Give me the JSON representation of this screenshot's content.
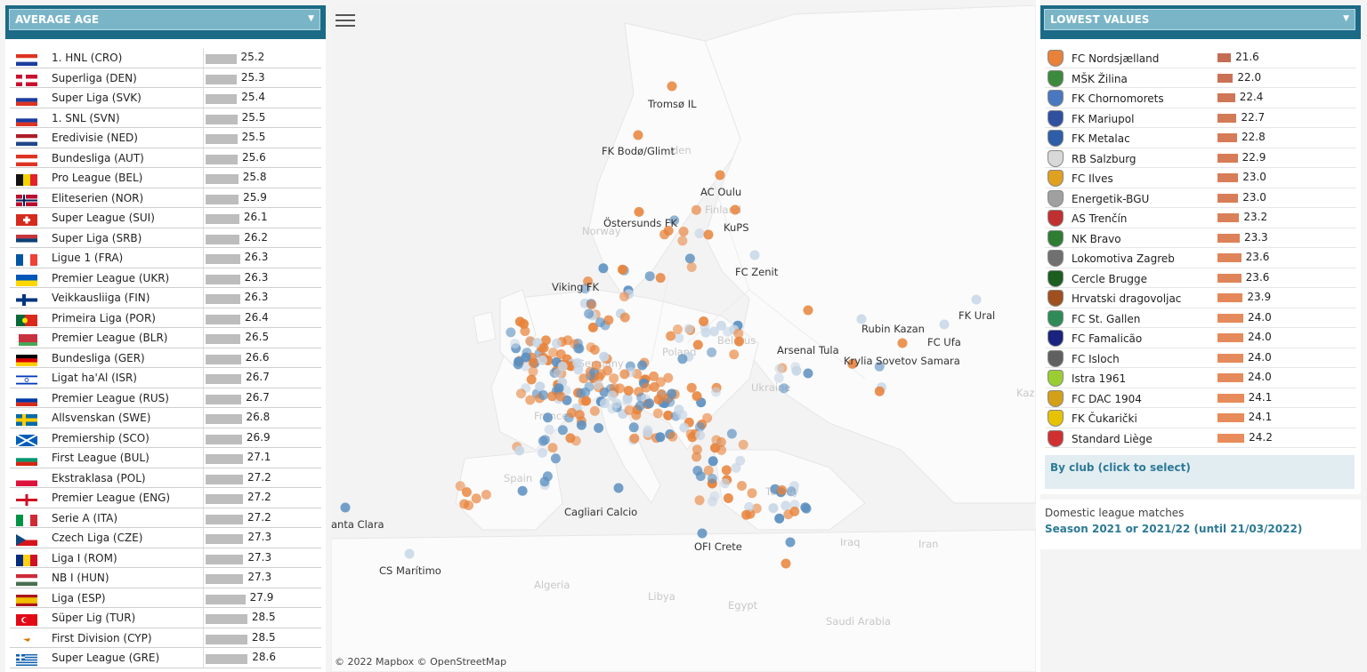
{
  "left_panel": {
    "title": "AVERAGE AGE",
    "leagues": [
      {
        "label": "1. HNL (CRO)",
        "value": "25.2",
        "avg": 25.2,
        "flag": "cro"
      },
      {
        "label": "Superliga (DEN)",
        "value": "25.3",
        "avg": 25.3,
        "flag": "den"
      },
      {
        "label": "Super Liga (SVK)",
        "value": "25.4",
        "avg": 25.4,
        "flag": "svk"
      },
      {
        "label": "1. SNL (SVN)",
        "value": "25.5",
        "avg": 25.5,
        "flag": "svn"
      },
      {
        "label": "Eredivisie (NED)",
        "value": "25.5",
        "avg": 25.5,
        "flag": "ned"
      },
      {
        "label": "Bundesliga (AUT)",
        "value": "25.6",
        "avg": 25.6,
        "flag": "aut"
      },
      {
        "label": "Pro League (BEL)",
        "value": "25.8",
        "avg": 25.8,
        "flag": "bel"
      },
      {
        "label": "Eliteserien (NOR)",
        "value": "25.9",
        "avg": 25.9,
        "flag": "nor"
      },
      {
        "label": "Super League (SUI)",
        "value": "26.1",
        "avg": 26.1,
        "flag": "sui"
      },
      {
        "label": "Super Liga (SRB)",
        "value": "26.2",
        "avg": 26.2,
        "flag": "srb"
      },
      {
        "label": "Ligue 1 (FRA)",
        "value": "26.3",
        "avg": 26.3,
        "flag": "fra"
      },
      {
        "label": "Premier League (UKR)",
        "value": "26.3",
        "avg": 26.3,
        "flag": "ukr"
      },
      {
        "label": "Veikkausliiga (FIN)",
        "value": "26.3",
        "avg": 26.3,
        "flag": "fin"
      },
      {
        "label": "Primeira Liga (POR)",
        "value": "26.4",
        "avg": 26.4,
        "flag": "por"
      },
      {
        "label": "Premier League (BLR)",
        "value": "26.5",
        "avg": 26.5,
        "flag": "blr"
      },
      {
        "label": "Bundesliga (GER)",
        "value": "26.6",
        "avg": 26.6,
        "flag": "ger"
      },
      {
        "label": "Ligat ha'Al (ISR)",
        "value": "26.7",
        "avg": 26.7,
        "flag": "isr"
      },
      {
        "label": "Premier League (RUS)",
        "value": "26.7",
        "avg": 26.7,
        "flag": "rus"
      },
      {
        "label": "Allsvenskan (SWE)",
        "value": "26.8",
        "avg": 26.8,
        "flag": "swe"
      },
      {
        "label": "Premiership (SCO)",
        "value": "26.9",
        "avg": 26.9,
        "flag": "sco"
      },
      {
        "label": "First League (BUL)",
        "value": "27.1",
        "avg": 27.1,
        "flag": "bul"
      },
      {
        "label": "Ekstraklasa (POL)",
        "value": "27.2",
        "avg": 27.2,
        "flag": "pol"
      },
      {
        "label": "Premier League (ENG)",
        "value": "27.2",
        "avg": 27.2,
        "flag": "eng"
      },
      {
        "label": "Serie A (ITA)",
        "value": "27.2",
        "avg": 27.2,
        "flag": "ita"
      },
      {
        "label": "Czech Liga (CZE)",
        "value": "27.3",
        "avg": 27.3,
        "flag": "cze"
      },
      {
        "label": "Liga I (ROM)",
        "value": "27.3",
        "avg": 27.3,
        "flag": "rom"
      },
      {
        "label": "NB I (HUN)",
        "value": "27.3",
        "avg": 27.3,
        "flag": "hun"
      },
      {
        "label": "Liga (ESP)",
        "value": "27.9",
        "avg": 27.9,
        "flag": "esp"
      },
      {
        "label": "Süper Lig (TUR)",
        "value": "28.5",
        "avg": 28.5,
        "flag": "tur"
      },
      {
        "label": "First Division (CYP)",
        "value": "28.5",
        "avg": 28.5,
        "flag": "cyp"
      },
      {
        "label": "Super League (GRE)",
        "value": "28.6",
        "avg": 28.6,
        "flag": "gre"
      }
    ]
  },
  "right_panel": {
    "title": "LOWEST VALUES",
    "clubs": [
      {
        "label": "FC Nordsjælland",
        "value": "21.6",
        "avg": 21.6,
        "crest": "#e8823a"
      },
      {
        "label": "MŠK Žilina",
        "value": "22.0",
        "avg": 22.0,
        "crest": "#3c8a3c"
      },
      {
        "label": "FK Chornomorets",
        "value": "22.4",
        "avg": 22.4,
        "crest": "#4a78c0"
      },
      {
        "label": "FK Mariupol",
        "value": "22.7",
        "avg": 22.7,
        "crest": "#3050a0"
      },
      {
        "label": "FK Metalac",
        "value": "22.8",
        "avg": 22.8,
        "crest": "#2e5ea8"
      },
      {
        "label": "RB Salzburg",
        "value": "22.9",
        "avg": 22.9,
        "crest": "#d8d8d8"
      },
      {
        "label": "FC Ilves",
        "value": "23.0",
        "avg": 23.0,
        "crest": "#e0a020"
      },
      {
        "label": "Energetik-BGU",
        "value": "23.0",
        "avg": 23.0,
        "crest": "#a0a0a0"
      },
      {
        "label": "AS Trenčín",
        "value": "23.2",
        "avg": 23.2,
        "crest": "#c03030"
      },
      {
        "label": "NK Bravo",
        "value": "23.3",
        "avg": 23.3,
        "crest": "#2e7d32"
      },
      {
        "label": "Lokomotiva Zagreb",
        "value": "23.6",
        "avg": 23.6,
        "crest": "#707070"
      },
      {
        "label": "Cercle Brugge",
        "value": "23.6",
        "avg": 23.6,
        "crest": "#1b5e20"
      },
      {
        "label": "Hrvatski dragovoljac",
        "value": "23.9",
        "avg": 23.9,
        "crest": "#a05020"
      },
      {
        "label": "FC St. Gallen",
        "value": "24.0",
        "avg": 24.0,
        "crest": "#2e8b57"
      },
      {
        "label": "FC Famalicão",
        "value": "24.0",
        "avg": 24.0,
        "crest": "#1a237e"
      },
      {
        "label": "FC Isloch",
        "value": "24.0",
        "avg": 24.0,
        "crest": "#606060"
      },
      {
        "label": "Istra 1961",
        "value": "24.0",
        "avg": 24.0,
        "crest": "#9acd32"
      },
      {
        "label": "FC DAC 1904",
        "value": "24.1",
        "avg": 24.1,
        "crest": "#d4a017"
      },
      {
        "label": "FK Čukarički",
        "value": "24.1",
        "avg": 24.1,
        "crest": "#e6c200"
      },
      {
        "label": "Standard Liège",
        "value": "24.2",
        "avg": 24.2,
        "crest": "#d03030"
      }
    ],
    "by_club_label": "By club (click to select)",
    "note_line1": "Domestic league matches",
    "note_line2": "Season 2021 or 2021/22  (until 21/03/2022)"
  },
  "map": {
    "attribution": "© 2022 Mapbox  © OpenStreetMap",
    "club_labels": [
      "Tromsø IL",
      "FK Bodø/Glimt",
      "AC Oulu",
      "KuPS",
      "Östersunds FK",
      "FC Zenit",
      "Viking FK",
      "Rubin Kazan",
      "FK Ural",
      "FC Ufa",
      "Arsenal Tula",
      "Krylia Sovetov Samara",
      "anta Clara",
      "CS Marítimo",
      "Cagliari Calcio",
      "OFI Crete"
    ],
    "geo_labels": [
      "Norway",
      "Finland",
      "den",
      "Belarus",
      "Poland",
      "Germany",
      "France",
      "Ukraine",
      "Spain",
      "Turkey",
      "Iraq",
      "Iran",
      "Algeria",
      "Libya",
      "Egypt",
      "Saudi Arabia",
      "Kaz"
    ],
    "colors": {
      "young": "#e8823a",
      "old": "#5b8fc0",
      "mid": "#c7d6e6"
    }
  }
}
